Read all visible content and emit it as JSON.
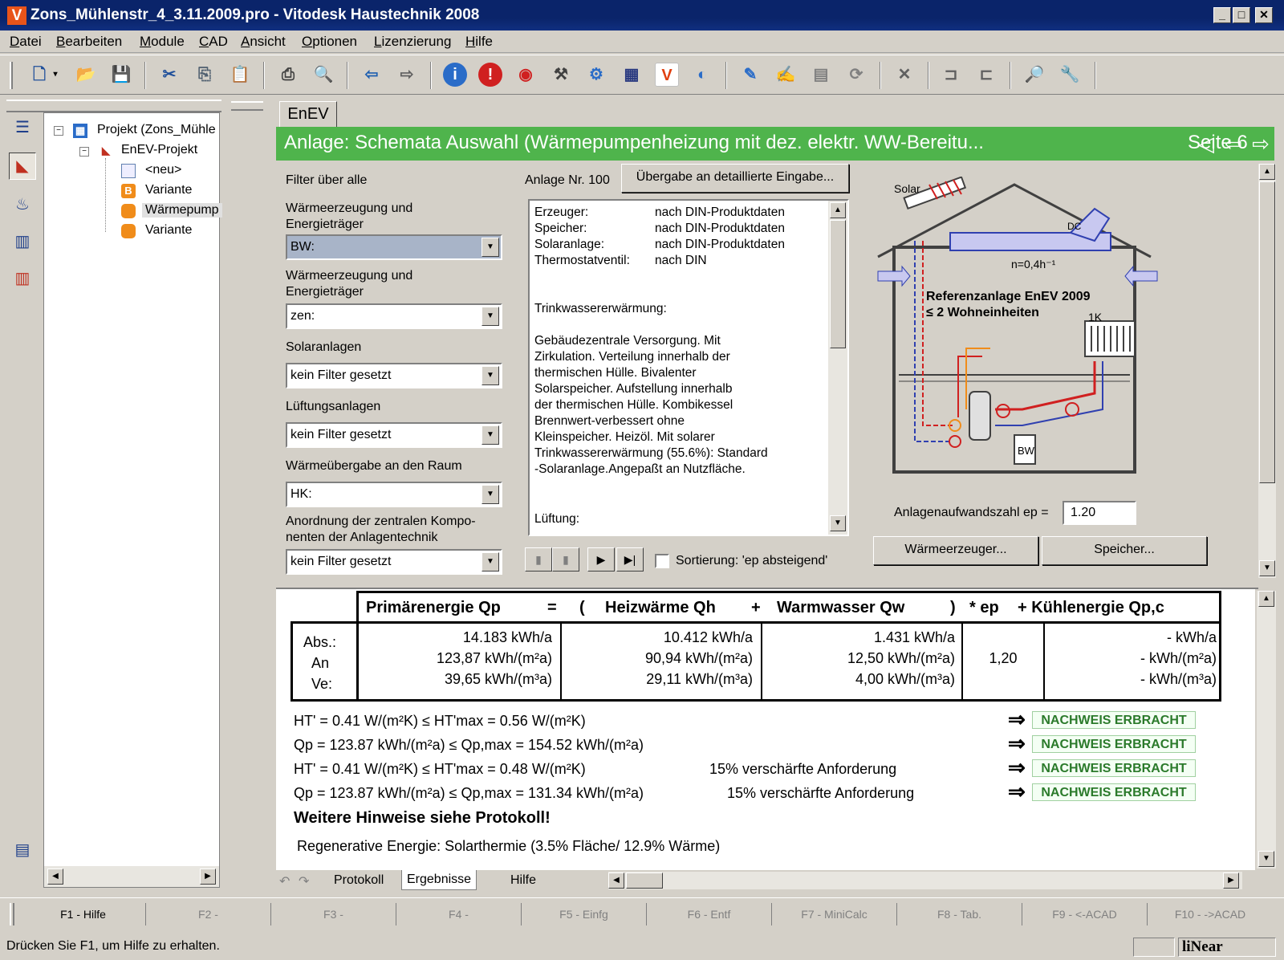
{
  "window": {
    "title": "Zons_Mühlenstr_4_3.11.2009.pro - Vitodesk Haustechnik 2008",
    "app_icon": "V",
    "controls": {
      "minimize": "_",
      "maximize": "□",
      "close": "✕"
    }
  },
  "menu": [
    "Datei",
    "Bearbeiten",
    "Module",
    "CAD",
    "Ansicht",
    "Optionen",
    "Lizenzierung",
    "Hilfe"
  ],
  "tree": {
    "root": "Projekt (Zons_Mühle",
    "child": "EnEV-Projekt",
    "items": [
      "<neu>",
      "Variante",
      "Wärmepump",
      "Variante"
    ],
    "badge_b": "B"
  },
  "tab": "EnEV",
  "header": {
    "title": "Anlage: Schemata Auswahl (Wärmepumpenheizung mit dez. elektr. WW-Bereitu...",
    "page": "Seite 6"
  },
  "filters": {
    "heading": "Filter über alle",
    "groups": [
      {
        "label": "Wärmeerzeugung und Energieträger",
        "value": "BW:"
      },
      {
        "label": "Wärmeerzeugung und Energieträger",
        "value": "zen:"
      },
      {
        "label": "Solaranlagen",
        "value": "kein Filter gesetzt"
      },
      {
        "label": "Lüftungsanlagen",
        "value": "kein Filter gesetzt"
      },
      {
        "label": "Wärmeübergabe an den Raum",
        "value": "HK:"
      },
      {
        "label": "Anordnung der zentralen Kompo-nenten der Anlagentechnik",
        "value": "kein Filter gesetzt"
      }
    ]
  },
  "anlage": {
    "nr_label": "Anlage Nr. 100",
    "transfer_button": "Übergabe an detaillierte Eingabe...",
    "info": [
      {
        "k": "Erzeuger:",
        "v": "nach DIN-Produktdaten"
      },
      {
        "k": "Speicher:",
        "v": "nach DIN-Produktdaten"
      },
      {
        "k": "Solaranlage:",
        "v": "nach DIN-Produktdaten"
      },
      {
        "k": "Thermostatventil:",
        "v": "nach DIN"
      }
    ],
    "tw_heading": "Trinkwassererwärmung:",
    "tw_text": [
      "Gebäudezentrale Versorgung. Mit",
      "Zirkulation. Verteilung innerhalb der",
      "thermischen Hülle. Bivalenter",
      "Solarspeicher. Aufstellung innerhalb",
      "der thermischen Hülle. Kombikessel",
      "Brennwert-verbessert ohne",
      "Kleinspeicher. Heizöl. Mit solarer",
      "Trinkwassererwärmung (55.6%): Standard",
      "-Solaranlage.Angepaßt an Nutzfläche."
    ],
    "lueftung": "Lüftung:",
    "sort_label": "Sortierung: 'ep absteigend'",
    "ep_label": "Anlagenaufwandszahl ep =",
    "ep_value": "1.20",
    "btn_waerme": "Wärmeerzeuger...",
    "btn_speicher": "Speicher..."
  },
  "diagram": {
    "solar": "Solar",
    "dc": "DC",
    "n": "n=0,4h⁻¹",
    "ref1": "Referenzanlage EnEV 2009",
    "ref2": "≤ 2 Wohneinheiten",
    "k1": "1K",
    "bw": "BW"
  },
  "results": {
    "headers": [
      "Primärenergie Qp",
      "=",
      "(",
      "Heizwärme Qh",
      "+",
      "Warmwasser Qw",
      ")",
      "* ep",
      "+ Kühlenergie Qp,c"
    ],
    "row_labels": [
      "Abs.:",
      "An",
      "Ve:"
    ],
    "primaer": [
      "14.183 kWh/a",
      "123,87 kWh/(m²a)",
      "39,65 kWh/(m³a)"
    ],
    "heiz": [
      "10.412  kWh/a",
      "90,94  kWh/(m²a)",
      "29,11  kWh/(m³a)"
    ],
    "warm": [
      "1.431  kWh/a",
      "12,50  kWh/(m²a)",
      "4,00  kWh/(m³a)"
    ],
    "ep": "1,20",
    "kuehl": [
      "- kWh/a",
      "- kWh/(m²a)",
      "- kWh/(m³a)"
    ]
  },
  "proofs": [
    {
      "text": "HT' = 0.41 W/(m²K)  ≤  HT'max = 0.56 W/(m²K)",
      "note": "",
      "badge": "NACHWEIS ERBRACHT"
    },
    {
      "text": "Qp = 123.87 kWh/(m²a)  ≤  Qp,max = 154.52 kWh/(m²a)",
      "note": "",
      "badge": "NACHWEIS ERBRACHT"
    },
    {
      "text": "HT' = 0.41 W/(m²K)  ≤  HT'max = 0.48 W/(m²K)",
      "note": "15% verschärfte Anforderung",
      "badge": "NACHWEIS ERBRACHT"
    },
    {
      "text": "Qp = 123.87 kWh/(m²a)  ≤  Qp,max = 131.34 kWh/(m²a)",
      "note": "15% verschärfte Anforderung",
      "badge": "NACHWEIS ERBRACHT"
    }
  ],
  "hint": "Weitere Hinweise siehe Protokoll!",
  "regen": "Regenerative Energie: Solarthermie (3.5% Fläche/ 12.9% Wärme)",
  "bottom_tabs": [
    "Protokoll",
    "Ergebnisse",
    "Hilfe"
  ],
  "fkeys": [
    "F1 - Hilfe",
    "F2 -",
    "F3 -",
    "F4 -",
    "F5 - Einfg",
    "F6 - Entf",
    "F7 - MiniCalc",
    "F8 - Tab.",
    "F9 - <-ACAD",
    "F10 - ->ACAD"
  ],
  "status": {
    "text": "Drücken Sie F1, um Hilfe zu erhalten.",
    "logo": "liNear"
  }
}
